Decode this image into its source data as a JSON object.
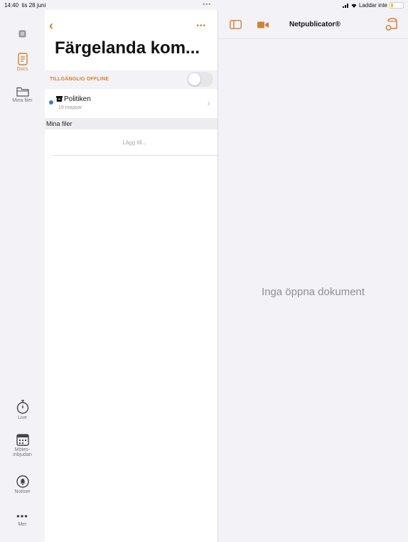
{
  "status_bar": {
    "time": "14:40",
    "date": "tis 28 juni",
    "battery_text": "Laddar inte"
  },
  "rail": {
    "items": [
      {
        "label": "",
        "icon": "square-icon"
      },
      {
        "label": "Docs",
        "icon": "docs-icon",
        "active": true
      },
      {
        "label": "Mina filer",
        "icon": "folder-icon"
      },
      {
        "label": "Live",
        "icon": "stopwatch-icon"
      },
      {
        "label": "Mötes-",
        "label2": "inbjudan",
        "icon": "calendar-icon"
      },
      {
        "label": "Notiser",
        "icon": "bell-icon"
      },
      {
        "label": "Mer",
        "icon": "ellipsis-icon"
      }
    ]
  },
  "middle": {
    "title": "Färgelanda kom...",
    "offline_label": "TILLGÄNGLIG OFFLINE",
    "offline_enabled": false,
    "items": [
      {
        "name": "Politiken",
        "sub": "19 mappar"
      }
    ],
    "section_label": "Mina filer",
    "add_label": "Lägg till..."
  },
  "main": {
    "title": "Netpublicator®",
    "empty_text": "Inga öppna dokument"
  },
  "colors": {
    "accent": "#d4822c",
    "background": "#f2f2f7",
    "dot": "#3a7be0"
  }
}
